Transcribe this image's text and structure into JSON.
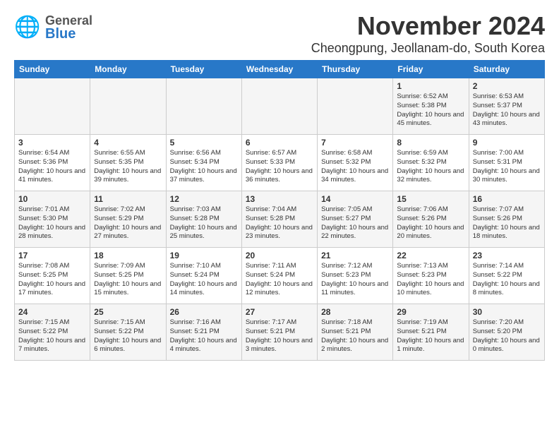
{
  "header": {
    "logo_general": "General",
    "logo_blue": "Blue",
    "month_title": "November 2024",
    "location": "Cheongpung, Jeollanam-do, South Korea"
  },
  "weekdays": [
    "Sunday",
    "Monday",
    "Tuesday",
    "Wednesday",
    "Thursday",
    "Friday",
    "Saturday"
  ],
  "weeks": [
    [
      {
        "day": "",
        "info": ""
      },
      {
        "day": "",
        "info": ""
      },
      {
        "day": "",
        "info": ""
      },
      {
        "day": "",
        "info": ""
      },
      {
        "day": "",
        "info": ""
      },
      {
        "day": "1",
        "info": "Sunrise: 6:52 AM\nSunset: 5:38 PM\nDaylight: 10 hours and 45 minutes."
      },
      {
        "day": "2",
        "info": "Sunrise: 6:53 AM\nSunset: 5:37 PM\nDaylight: 10 hours and 43 minutes."
      }
    ],
    [
      {
        "day": "3",
        "info": "Sunrise: 6:54 AM\nSunset: 5:36 PM\nDaylight: 10 hours and 41 minutes."
      },
      {
        "day": "4",
        "info": "Sunrise: 6:55 AM\nSunset: 5:35 PM\nDaylight: 10 hours and 39 minutes."
      },
      {
        "day": "5",
        "info": "Sunrise: 6:56 AM\nSunset: 5:34 PM\nDaylight: 10 hours and 37 minutes."
      },
      {
        "day": "6",
        "info": "Sunrise: 6:57 AM\nSunset: 5:33 PM\nDaylight: 10 hours and 36 minutes."
      },
      {
        "day": "7",
        "info": "Sunrise: 6:58 AM\nSunset: 5:32 PM\nDaylight: 10 hours and 34 minutes."
      },
      {
        "day": "8",
        "info": "Sunrise: 6:59 AM\nSunset: 5:32 PM\nDaylight: 10 hours and 32 minutes."
      },
      {
        "day": "9",
        "info": "Sunrise: 7:00 AM\nSunset: 5:31 PM\nDaylight: 10 hours and 30 minutes."
      }
    ],
    [
      {
        "day": "10",
        "info": "Sunrise: 7:01 AM\nSunset: 5:30 PM\nDaylight: 10 hours and 28 minutes."
      },
      {
        "day": "11",
        "info": "Sunrise: 7:02 AM\nSunset: 5:29 PM\nDaylight: 10 hours and 27 minutes."
      },
      {
        "day": "12",
        "info": "Sunrise: 7:03 AM\nSunset: 5:28 PM\nDaylight: 10 hours and 25 minutes."
      },
      {
        "day": "13",
        "info": "Sunrise: 7:04 AM\nSunset: 5:28 PM\nDaylight: 10 hours and 23 minutes."
      },
      {
        "day": "14",
        "info": "Sunrise: 7:05 AM\nSunset: 5:27 PM\nDaylight: 10 hours and 22 minutes."
      },
      {
        "day": "15",
        "info": "Sunrise: 7:06 AM\nSunset: 5:26 PM\nDaylight: 10 hours and 20 minutes."
      },
      {
        "day": "16",
        "info": "Sunrise: 7:07 AM\nSunset: 5:26 PM\nDaylight: 10 hours and 18 minutes."
      }
    ],
    [
      {
        "day": "17",
        "info": "Sunrise: 7:08 AM\nSunset: 5:25 PM\nDaylight: 10 hours and 17 minutes."
      },
      {
        "day": "18",
        "info": "Sunrise: 7:09 AM\nSunset: 5:25 PM\nDaylight: 10 hours and 15 minutes."
      },
      {
        "day": "19",
        "info": "Sunrise: 7:10 AM\nSunset: 5:24 PM\nDaylight: 10 hours and 14 minutes."
      },
      {
        "day": "20",
        "info": "Sunrise: 7:11 AM\nSunset: 5:24 PM\nDaylight: 10 hours and 12 minutes."
      },
      {
        "day": "21",
        "info": "Sunrise: 7:12 AM\nSunset: 5:23 PM\nDaylight: 10 hours and 11 minutes."
      },
      {
        "day": "22",
        "info": "Sunrise: 7:13 AM\nSunset: 5:23 PM\nDaylight: 10 hours and 10 minutes."
      },
      {
        "day": "23",
        "info": "Sunrise: 7:14 AM\nSunset: 5:22 PM\nDaylight: 10 hours and 8 minutes."
      }
    ],
    [
      {
        "day": "24",
        "info": "Sunrise: 7:15 AM\nSunset: 5:22 PM\nDaylight: 10 hours and 7 minutes."
      },
      {
        "day": "25",
        "info": "Sunrise: 7:15 AM\nSunset: 5:22 PM\nDaylight: 10 hours and 6 minutes."
      },
      {
        "day": "26",
        "info": "Sunrise: 7:16 AM\nSunset: 5:21 PM\nDaylight: 10 hours and 4 minutes."
      },
      {
        "day": "27",
        "info": "Sunrise: 7:17 AM\nSunset: 5:21 PM\nDaylight: 10 hours and 3 minutes."
      },
      {
        "day": "28",
        "info": "Sunrise: 7:18 AM\nSunset: 5:21 PM\nDaylight: 10 hours and 2 minutes."
      },
      {
        "day": "29",
        "info": "Sunrise: 7:19 AM\nSunset: 5:21 PM\nDaylight: 10 hours and 1 minute."
      },
      {
        "day": "30",
        "info": "Sunrise: 7:20 AM\nSunset: 5:20 PM\nDaylight: 10 hours and 0 minutes."
      }
    ]
  ]
}
